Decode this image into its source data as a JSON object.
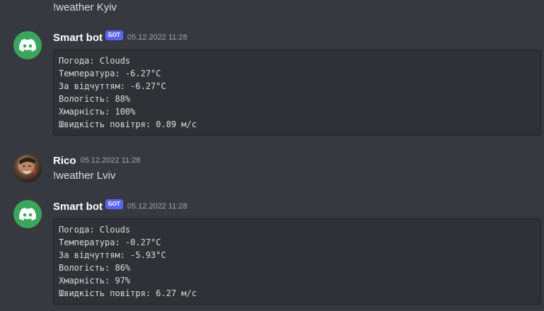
{
  "messages": {
    "prev_text": "!weather Kyiv",
    "bot1": {
      "username": "Smart bot",
      "tag": "БОТ",
      "timestamp": "05.12.2022 11:28",
      "lines": [
        "Погода: Clouds",
        "Температура: -6.27°C",
        "За відчуттям: -6.27°C",
        "Вологість: 88%",
        "Хмарність: 100%",
        "Швидкість повітря: 0.89 м/с"
      ]
    },
    "user": {
      "username": "Rico",
      "timestamp": "05.12.2022 11:28",
      "text": "!weather Lviv"
    },
    "bot2": {
      "username": "Smart bot",
      "tag": "БОТ",
      "timestamp": "05.12.2022 11:28",
      "lines": [
        "Погода: Clouds",
        "Температура: -0.27°C",
        "За відчуттям: -5.93°C",
        "Вологість: 86%",
        "Хмарність: 97%",
        "Швидкість повітря: 6.27 м/с"
      ]
    }
  },
  "icons": {
    "bot_avatar": "discord-logo-icon",
    "user_avatar": "user-photo-avatar"
  },
  "colors": {
    "background": "#36393f",
    "codeblock": "#2f3136",
    "bot_tag": "#5865f2",
    "bot_avatar": "#3ba55d"
  }
}
